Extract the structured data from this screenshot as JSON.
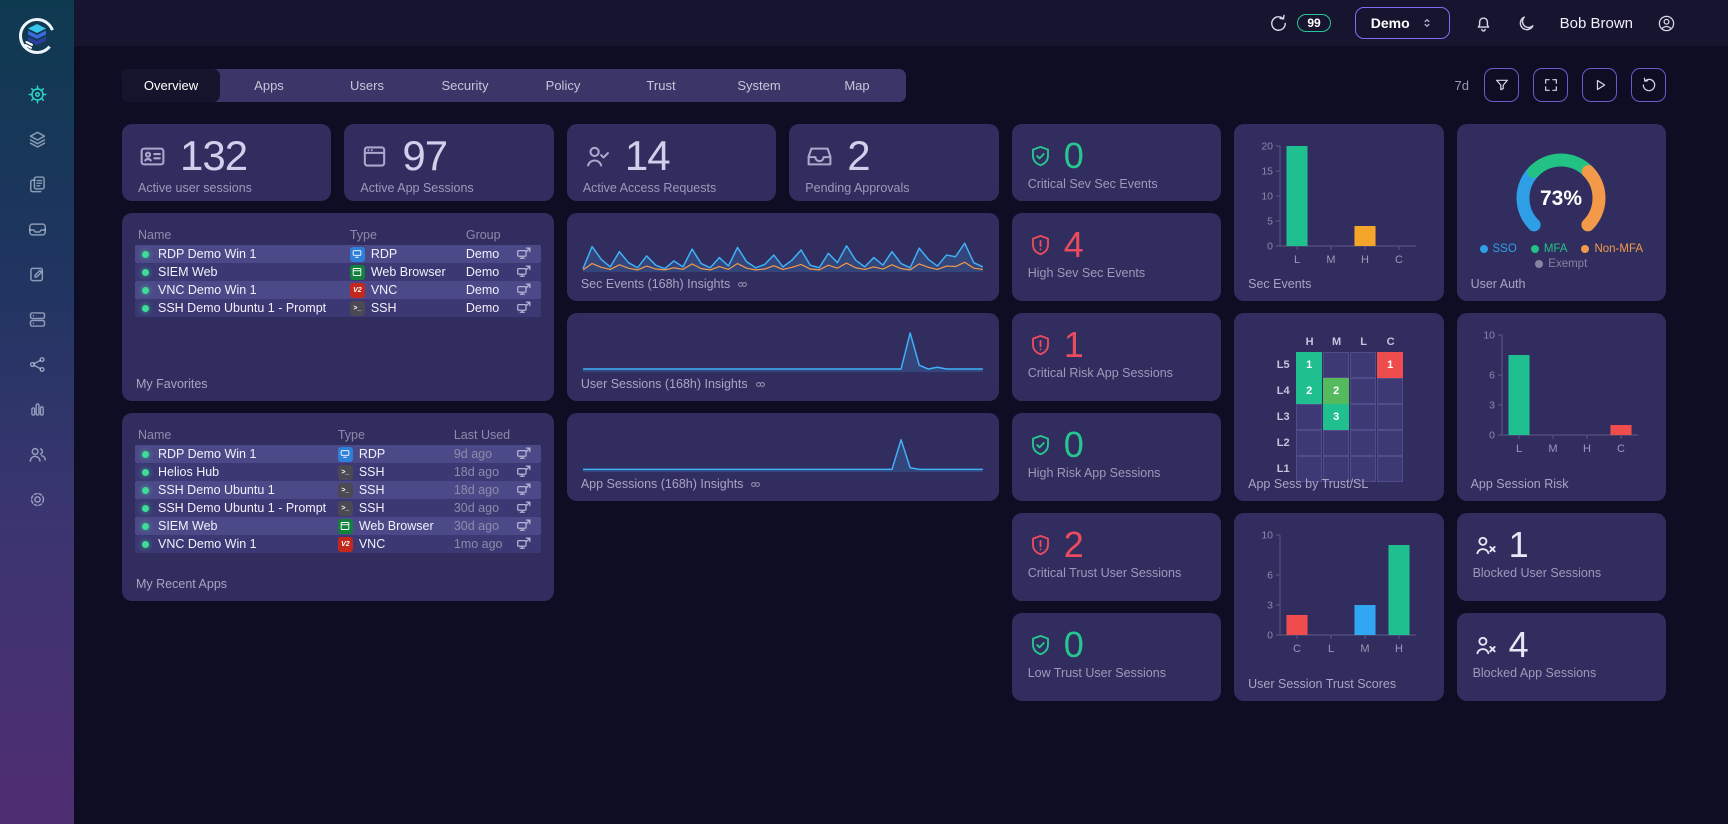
{
  "topbar": {
    "refresh_badge": "99",
    "org": "Demo",
    "user": "Bob Brown"
  },
  "nav_tabs": {
    "active": "Overview",
    "items": [
      "Overview",
      "Apps",
      "Users",
      "Security",
      "Policy",
      "Trust",
      "System",
      "Map"
    ]
  },
  "toolbar": {
    "time_range": "7d"
  },
  "sidebar": {
    "items": [
      {
        "icon": "helm",
        "active": true
      },
      {
        "icon": "layers"
      },
      {
        "icon": "pages"
      },
      {
        "icon": "tray"
      },
      {
        "icon": "book-pen"
      },
      {
        "icon": "servers"
      },
      {
        "icon": "share"
      },
      {
        "icon": "bars"
      },
      {
        "icon": "users"
      },
      {
        "icon": "gear"
      }
    ]
  },
  "stat_cards": [
    {
      "icon": "id-card",
      "value": "132",
      "label": "Active user sessions"
    },
    {
      "icon": "app-window",
      "value": "97",
      "label": "Active App Sessions"
    },
    {
      "icon": "user-check",
      "value": "14",
      "label": "Active Access Requests"
    },
    {
      "icon": "inbox",
      "value": "2",
      "label": "Pending Approvals"
    }
  ],
  "severity_cards": [
    {
      "icon": "shield-check",
      "tone": "green",
      "value": "0",
      "label": "Critical Sev Sec Events"
    },
    {
      "icon": "shield-alert",
      "tone": "red",
      "value": "4",
      "label": "High Sev Sec Events"
    },
    {
      "icon": "shield-alert",
      "tone": "red",
      "value": "1",
      "label": "Critical Risk App Sessions"
    },
    {
      "icon": "shield-check",
      "tone": "green",
      "value": "0",
      "label": "High Risk App Sessions"
    },
    {
      "icon": "shield-alert",
      "tone": "red",
      "value": "2",
      "label": "Critical Trust User Sessions"
    },
    {
      "icon": "shield-check",
      "tone": "green",
      "value": "0",
      "label": "Low Trust User Sessions"
    }
  ],
  "blocked_cards": [
    {
      "icon": "user-x",
      "value": "1",
      "label": "Blocked User Sessions"
    },
    {
      "icon": "user-x",
      "value": "4",
      "label": "Blocked App Sessions"
    }
  ],
  "favorites": {
    "title": "My Favorites",
    "columns": [
      "Name",
      "Type",
      "Group"
    ],
    "rows": [
      {
        "name": "RDP Demo Win 1",
        "type": "RDP",
        "value": "Demo"
      },
      {
        "name": "SIEM Web",
        "type": "Web Browser",
        "value": "Demo"
      },
      {
        "name": "VNC Demo Win 1",
        "type": "VNC",
        "value": "Demo"
      },
      {
        "name": "SSH Demo Ubuntu 1 - Prompt",
        "type": "SSH",
        "value": "Demo"
      }
    ]
  },
  "recent_apps": {
    "title": "My Recent Apps",
    "columns": [
      "Name",
      "Type",
      "Last Used"
    ],
    "rows": [
      {
        "name": "RDP Demo Win 1",
        "type": "RDP",
        "value": "9d ago"
      },
      {
        "name": "Helios Hub",
        "type": "SSH",
        "value": "18d ago"
      },
      {
        "name": "SSH Demo Ubuntu 1",
        "type": "SSH",
        "value": "18d ago"
      },
      {
        "name": "SSH Demo Ubuntu 1 - Prompt",
        "type": "SSH",
        "value": "30d ago"
      },
      {
        "name": "SIEM Web",
        "type": "Web Browser",
        "value": "30d ago"
      },
      {
        "name": "VNC Demo Win 1",
        "type": "VNC",
        "value": "1mo ago"
      }
    ]
  },
  "chart_data": [
    {
      "id": "sec-events-insights",
      "type": "area",
      "title": "Sec Events (168h) Insights",
      "x_span_hours": 168,
      "series": [
        {
          "name": "events",
          "color": "#3fb0f8",
          "values": [
            6,
            58,
            28,
            10,
            46,
            20,
            8,
            36,
            14,
            6,
            24,
            10,
            52,
            18,
            8,
            32,
            12,
            56,
            22,
            8,
            16,
            38,
            10,
            26,
            50,
            14,
            8,
            42,
            20,
            60,
            26,
            10,
            32,
            14,
            46,
            18,
            8,
            54,
            28,
            12,
            38,
            34,
            66,
            20,
            10
          ]
        },
        {
          "name": "alerts",
          "color": "#f2984a",
          "values": [
            3,
            18,
            9,
            4,
            15,
            7,
            3,
            12,
            5,
            3,
            8,
            4,
            17,
            6,
            3,
            11,
            4,
            18,
            7,
            3,
            5,
            13,
            4,
            9,
            16,
            5,
            3,
            14,
            7,
            19,
            8,
            4,
            10,
            5,
            15,
            6,
            3,
            17,
            9,
            4,
            12,
            11,
            21,
            7,
            4
          ]
        }
      ]
    },
    {
      "id": "user-sessions-insights",
      "type": "area",
      "title": "User Sessions (168h) Insights",
      "x_span_hours": 168,
      "series": [
        {
          "name": "sessions",
          "color": "#3fb0f8",
          "values": [
            5,
            5,
            5,
            5,
            5,
            5,
            5,
            5,
            5,
            5,
            5,
            5,
            5,
            5,
            5,
            5,
            5,
            5,
            5,
            5,
            5,
            5,
            5,
            5,
            5,
            5,
            5,
            5,
            5,
            5,
            5,
            5,
            5,
            5,
            5,
            5,
            90,
            14,
            5,
            9,
            5,
            5,
            5,
            5,
            5
          ]
        }
      ]
    },
    {
      "id": "app-sessions-insights",
      "type": "area",
      "title": "App Sessions (168h) Insights",
      "x_span_hours": 168,
      "series": [
        {
          "name": "sessions",
          "color": "#3fb0f8",
          "values": [
            4,
            4,
            4,
            4,
            4,
            4,
            4,
            4,
            4,
            4,
            4,
            4,
            4,
            4,
            4,
            4,
            4,
            4,
            4,
            4,
            4,
            4,
            4,
            4,
            4,
            4,
            4,
            4,
            4,
            4,
            4,
            4,
            4,
            4,
            4,
            74,
            8,
            4,
            4,
            4,
            4,
            4,
            4,
            4,
            4
          ]
        }
      ]
    },
    {
      "id": "sec-events",
      "type": "bar",
      "title": "Sec Events",
      "categories": [
        "L",
        "M",
        "H",
        "C"
      ],
      "values": [
        20,
        0,
        4,
        0
      ],
      "bar_colors": [
        "#1fbf8f",
        "#1fbf8f",
        "#f5a62a",
        "#1fbf8f"
      ],
      "yticks": [
        0,
        5,
        10,
        15,
        20
      ],
      "ymax": 20
    },
    {
      "id": "user-auth",
      "type": "donut",
      "title": "User Auth",
      "center_label": "73%",
      "segments": [
        {
          "label": "SSO",
          "value": 33,
          "color": "#2e9fe6"
        },
        {
          "label": "MFA",
          "value": 34,
          "color": "#22c284"
        },
        {
          "label": "Non-MFA",
          "value": 33,
          "color": "#f2994a"
        }
      ],
      "legend_secondary": [
        {
          "label": "Exempt",
          "value": 0,
          "color": "#85839f"
        }
      ]
    },
    {
      "id": "app-sess-heatmap",
      "type": "heatmap",
      "title": "App Sess by Trust/SL",
      "columns": [
        "H",
        "M",
        "L",
        "C"
      ],
      "rows": [
        "L5",
        "L4",
        "L3",
        "L2",
        "L1"
      ],
      "cells": [
        {
          "row": "L5",
          "col": "H",
          "value": 1,
          "color": "#1fbf8f"
        },
        {
          "row": "L5",
          "col": "C",
          "value": 1,
          "color": "#ef4d4d"
        },
        {
          "row": "L4",
          "col": "H",
          "value": 2,
          "color": "#1fbf8f"
        },
        {
          "row": "L4",
          "col": "M",
          "value": 2,
          "color": "#55b95e"
        },
        {
          "row": "L3",
          "col": "M",
          "value": 3,
          "color": "#1fbf8f"
        }
      ]
    },
    {
      "id": "app-session-risk",
      "type": "bar",
      "title": "App Session Risk",
      "categories": [
        "L",
        "M",
        "H",
        "C"
      ],
      "values": [
        8,
        0,
        0,
        1
      ],
      "bar_colors": [
        "#1fbf8f",
        "#1fbf8f",
        "#1fbf8f",
        "#ef4d4d"
      ],
      "yticks": [
        0,
        3,
        6,
        10
      ],
      "ymax": 10
    },
    {
      "id": "user-session-trust",
      "type": "bar",
      "title": "User Session Trust Scores",
      "categories": [
        "C",
        "L",
        "M",
        "H"
      ],
      "values": [
        2,
        0,
        3,
        9
      ],
      "bar_colors": [
        "#ef4d4d",
        "#1fbf8f",
        "#31a6f2",
        "#1fbf8f"
      ],
      "yticks": [
        0,
        3,
        6,
        10
      ],
      "ymax": 10
    }
  ]
}
